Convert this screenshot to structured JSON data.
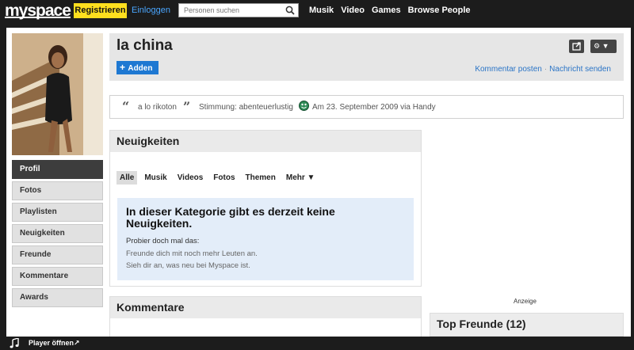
{
  "topbar": {
    "logo": "myspace",
    "register_label": "Registrieren",
    "login_label": "Einloggen",
    "search_placeholder": "Personen suchen",
    "nav": [
      "Musik",
      "Video",
      "Games",
      "Browse People"
    ]
  },
  "sidebar": {
    "items": [
      "Profil",
      "Fotos",
      "Playlisten",
      "Neuigkeiten",
      "Freunde",
      "Kommentare",
      "Awards"
    ],
    "active": "Profil"
  },
  "profile": {
    "name": "la china",
    "add_label": "Adden",
    "links": [
      "Kommentar posten",
      "Nachricht senden"
    ]
  },
  "status": {
    "text": "a lo rikoton",
    "mood": "Stimmung: abenteuerlustig",
    "date": "Am 23. September 2009 via Handy"
  },
  "news": {
    "title": "Neuigkeiten",
    "tabs": [
      "Alle",
      "Musik",
      "Videos",
      "Fotos",
      "Themen",
      "Mehr ▼"
    ],
    "active_tab": "Alle",
    "empty_title": "In dieser Kategorie gibt es derzeit keine Neuigkeiten.",
    "empty_line1": "Probier doch mal das:",
    "empty_line2": "Freunde dich mit noch mehr Leuten an.",
    "empty_line3": "Sieh dir an, was neu bei Myspace ist."
  },
  "comments": {
    "title": "Kommentare"
  },
  "ad": {
    "label": "Anzeige"
  },
  "top_friends": {
    "title": "Top Freunde (12)"
  },
  "player": {
    "label": "Player öffnen↗"
  },
  "colors": {
    "topbar": "#1c1c1c",
    "register": "#ffdf1e",
    "link": "#2a74c6",
    "add_button": "#1e78d2",
    "empty_box": "#e3edf9"
  }
}
